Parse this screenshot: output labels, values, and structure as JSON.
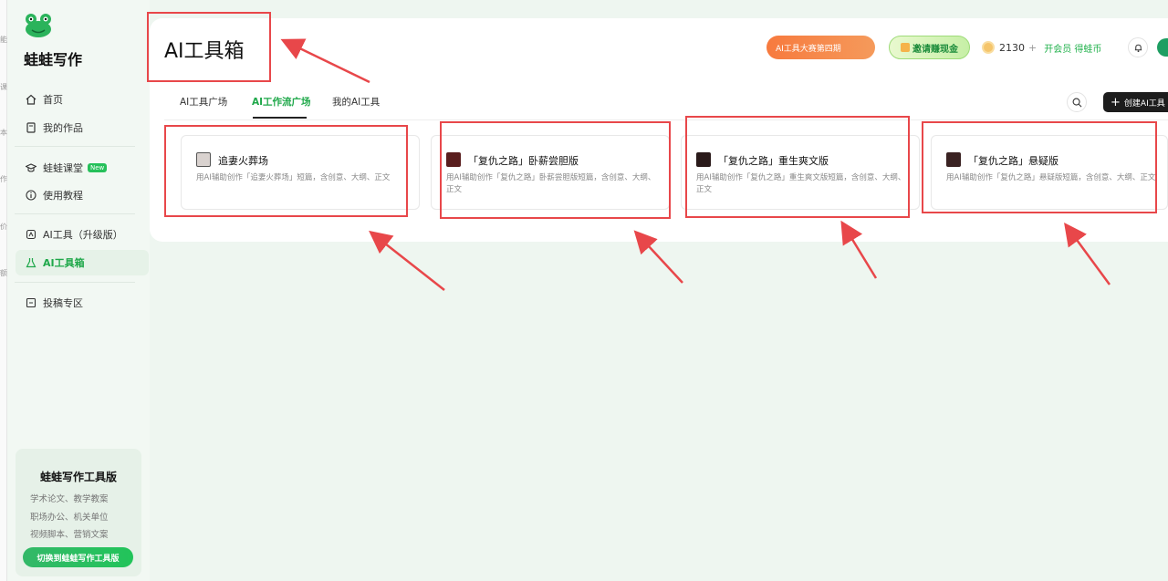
{
  "edge_labels": [
    "能",
    "课",
    "本",
    "作",
    "价",
    "额"
  ],
  "sidebar": {
    "brand": "蛙蛙写作",
    "items": [
      {
        "label": "首页",
        "icon": "home-icon"
      },
      {
        "label": "我的作品",
        "icon": "file-icon"
      },
      {
        "label": "蛙蛙课堂",
        "icon": "graduation-cap-icon",
        "badge": "New"
      },
      {
        "label": "使用教程",
        "icon": "info-icon"
      },
      {
        "label": "AI工具（升级版）",
        "icon": "ai-tool-icon"
      },
      {
        "label": "AI工具箱",
        "icon": "flask-icon"
      },
      {
        "label": "投稿专区",
        "icon": "submit-icon"
      }
    ],
    "promo": {
      "title": "蛙蛙写作工具版",
      "lines": [
        "学术论文、教学教案",
        "职场办公、机关单位",
        "视频脚本、营销文案"
      ],
      "button": "切换到蛙蛙写作工具版"
    }
  },
  "header": {
    "title": "AI工具箱",
    "contest_label": "AI工具大赛第四期",
    "invite_label": "邀请赚现金",
    "coins": "2130",
    "coins_plus": "+",
    "member_link": "开会员 得蛙币"
  },
  "tabs": [
    {
      "label": "AI工具广场"
    },
    {
      "label": "AI工作流广场"
    },
    {
      "label": "我的AI工具"
    }
  ],
  "create_button": "创建AI工具",
  "cards": [
    {
      "title": "追妻火葬场",
      "desc": "用AI辅助创作「追妻火葬场」短篇，含创意、大纲、正文"
    },
    {
      "title": "「复仇之路」卧薪尝胆版",
      "desc": "用AI辅助创作「复仇之路」卧薪尝胆版短篇，含创意、大纲、正文"
    },
    {
      "title": "「复仇之路」重生爽文版",
      "desc": "用AI辅助创作「复仇之路」重生爽文版短篇，含创意、大纲、正文"
    },
    {
      "title": "「复仇之路」悬疑版",
      "desc": "用AI辅助创作「复仇之路」悬疑版短篇，含创意、大纲、正文"
    }
  ],
  "colors": {
    "accent": "#1fa84a",
    "annotation_red": "#e8474a",
    "contest_orange": "#f77a3e"
  }
}
